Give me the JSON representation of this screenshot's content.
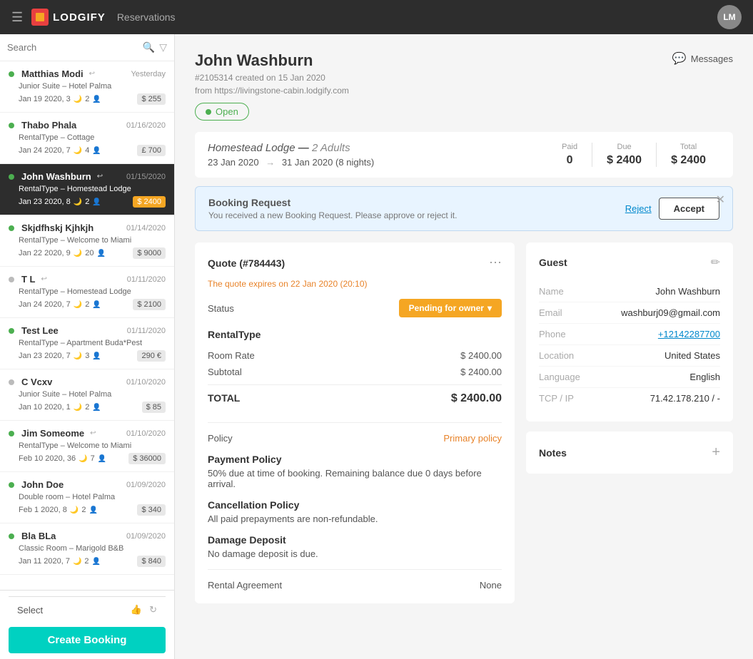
{
  "topnav": {
    "logo_text": "LODGIFY",
    "title": "Reservations",
    "user_initials": "LM"
  },
  "sidebar": {
    "search_placeholder": "Search",
    "select_label": "Select",
    "create_booking_label": "Create Booking",
    "items": [
      {
        "id": "matthias-modi",
        "name": "Matthias Modi",
        "date": "Yesterday",
        "sub": "Junior Suite – Hotel Palma",
        "dates": "Jan 19 2020, 3",
        "guests": "2",
        "badge": "$ 255",
        "dot": "green",
        "active": false,
        "has_reply": true
      },
      {
        "id": "thabo-phala",
        "name": "Thabo Phala",
        "date": "01/16/2020",
        "sub": "RentalType – Cottage",
        "dates": "Jan 24 2020, 7",
        "guests": "4",
        "badge": "£ 700",
        "dot": "green",
        "active": false
      },
      {
        "id": "john-washburn",
        "name": "John Washburn",
        "date": "01/15/2020",
        "sub": "RentalType – Homestead Lodge",
        "dates": "Jan 23 2020, 8",
        "guests": "2",
        "badge": "$ 2400",
        "dot": "green",
        "active": true,
        "has_reply": true
      },
      {
        "id": "skjdfhskj-kjhkjh",
        "name": "Skjdfhskj Kjhkjh",
        "date": "01/14/2020",
        "sub": "RentalType – Welcome to Miami",
        "dates": "Jan 22 2020, 9",
        "guests": "20",
        "badge": "$ 9000",
        "dot": "green",
        "active": false
      },
      {
        "id": "t-l",
        "name": "T L",
        "date": "01/11/2020",
        "sub": "RentalType – Homestead Lodge",
        "dates": "Jan 24 2020, 7",
        "guests": "2",
        "badge": "$ 2100",
        "dot": "gray",
        "active": false,
        "has_reply": true
      },
      {
        "id": "test-lee",
        "name": "Test Lee",
        "date": "01/11/2020",
        "sub": "RentalType – Apartment Buda*Pest",
        "dates": "Jan 23 2020, 7",
        "guests": "3",
        "badge": "290 €",
        "dot": "green",
        "active": false
      },
      {
        "id": "c-vcxv",
        "name": "C Vcxv",
        "date": "01/10/2020",
        "sub": "Junior Suite – Hotel Palma",
        "dates": "Jan 10 2020, 1",
        "guests": "2",
        "badge": "$ 85",
        "dot": "gray",
        "active": false
      },
      {
        "id": "jim-someome",
        "name": "Jim Someome",
        "date": "01/10/2020",
        "sub": "RentalType – Welcome to Miami",
        "dates": "Feb 10 2020, 36",
        "guests": "7",
        "badge": "$ 36000",
        "dot": "green",
        "active": false,
        "has_reply": true
      },
      {
        "id": "john-doe",
        "name": "John Doe",
        "date": "01/09/2020",
        "sub": "Double room – Hotel Palma",
        "dates": "Feb 1 2020, 8",
        "guests": "2",
        "badge": "$ 340",
        "dot": "green",
        "active": false
      },
      {
        "id": "bla-bla",
        "name": "Bla BLa",
        "date": "01/09/2020",
        "sub": "Classic Room – Marigold B&B",
        "dates": "Jan 11 2020, 7",
        "guests": "2",
        "badge": "$ 840",
        "dot": "green",
        "active": false
      }
    ]
  },
  "booking": {
    "guest_name": "John Washburn",
    "booking_id": "#2105314",
    "created_date": "created on 15 Jan 2020",
    "source_url": "from https://livingstone-cabin.lodgify.com",
    "status": "Open",
    "messages_label": "Messages",
    "property_name": "Homestead Lodge",
    "adults": "2 Adults",
    "check_in": "23 Jan 2020",
    "check_out": "31 Jan 2020",
    "nights": "8 nights",
    "paid_label": "Paid",
    "due_label": "Due",
    "total_label": "Total",
    "paid_value": "0",
    "due_value": "$ 2400",
    "total_value": "$ 2400",
    "banner_title": "Booking Request",
    "banner_sub": "You received a new Booking Request. Please approve or reject it.",
    "reject_label": "Reject",
    "accept_label": "Accept",
    "quote_title": "Quote (#784443)",
    "quote_expires": "The quote expires on 22 Jan 2020 (20:10)",
    "status_label": "Status",
    "status_value": "Pending for owner",
    "rental_type_title": "RentalType",
    "room_rate_label": "Room Rate",
    "room_rate_value": "$ 2400.00",
    "subtotal_label": "Subtotal",
    "subtotal_value": "$ 2400.00",
    "total_row_label": "TOTAL",
    "total_row_value": "$ 2400.00",
    "policy_label": "Policy",
    "policy_value": "Primary policy",
    "payment_policy_title": "Payment Policy",
    "payment_policy_text": "50% due at time of booking. Remaining balance due 0 days before arrival.",
    "cancellation_policy_title": "Cancellation Policy",
    "cancellation_policy_text": "All paid prepayments are non-refundable.",
    "damage_deposit_title": "Damage Deposit",
    "damage_deposit_text": "No damage deposit is due.",
    "rental_agreement_label": "Rental Agreement",
    "rental_agreement_value": "None",
    "guest_section_title": "Guest",
    "guest_name_label": "Name",
    "guest_name_value": "John Washburn",
    "email_label": "Email",
    "email_value": "washburj09@gmail.com",
    "phone_label": "Phone",
    "phone_value": "+12142287700",
    "location_label": "Location",
    "location_value": "United States",
    "language_label": "Language",
    "language_value": "English",
    "tcp_label": "TCP / IP",
    "tcp_value": "71.42.178.210 / -",
    "notes_title": "Notes"
  }
}
